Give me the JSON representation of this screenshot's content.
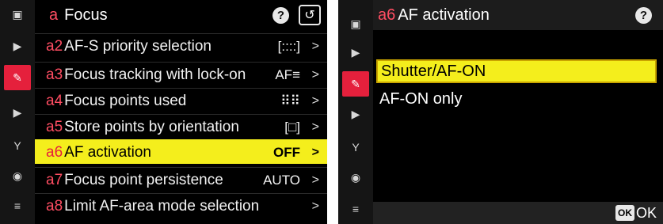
{
  "sidebar_icons": [
    "camera-icon",
    "movie-icon",
    "pencil-icon",
    "playback-icon",
    "wrench-icon",
    "network-icon",
    "my-menu-icon"
  ],
  "sidebar_glyphs": [
    "▣",
    "▶",
    "✎",
    "▶",
    "Y",
    "◉",
    "≡"
  ],
  "left": {
    "menu_code": "a",
    "title": "Focus",
    "help_label": "?",
    "back_label": "↺",
    "items": [
      {
        "code": "a2",
        "label": "AF-S priority selection",
        "value": "[::::]",
        "chevron": ">"
      },
      {
        "code": "a3",
        "label": "Focus tracking with lock-on",
        "value": "AF≡",
        "chevron": ">"
      },
      {
        "code": "a4",
        "label": "Focus points used",
        "value": "⠿⠿",
        "chevron": ">"
      },
      {
        "code": "a5",
        "label": "Store points by orientation",
        "value": "[□]",
        "chevron": ">"
      },
      {
        "code": "a6",
        "label": "AF activation",
        "value": "OFF",
        "chevron": ">"
      },
      {
        "code": "a7",
        "label": "Focus point persistence",
        "value": "AUTO",
        "chevron": ">"
      },
      {
        "code": "a8",
        "label": "Limit AF-area mode selection",
        "value": "",
        "chevron": ">"
      }
    ]
  },
  "right": {
    "code": "a6",
    "title": "AF activation",
    "help_label": "?",
    "options": [
      "Shutter/AF-ON",
      "AF-ON only"
    ],
    "ok_icon": "OK",
    "ok_text": "OK"
  },
  "colors": {
    "accent": "#e5203c",
    "highlight": "#f4ee1c"
  }
}
